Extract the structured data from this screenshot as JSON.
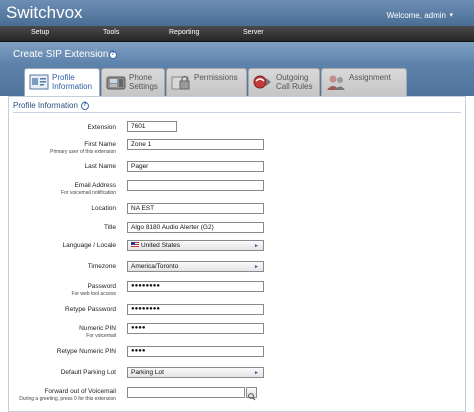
{
  "app": {
    "name": "Switchvox",
    "welcome": "Welcome, admin"
  },
  "nav": {
    "items": [
      "Setup",
      "Tools",
      "Reporting",
      "Server"
    ]
  },
  "page": {
    "title": "Create SIP Extension",
    "help": "?"
  },
  "tabs": [
    {
      "label1": "Profile",
      "label2": "Information",
      "icon": "profile-card-icon",
      "active": true
    },
    {
      "label1": "Phone",
      "label2": "Settings",
      "icon": "phone-icon",
      "active": false
    },
    {
      "label1": "Permissions",
      "label2": "",
      "icon": "lock-folder-icon",
      "active": false
    },
    {
      "label1": "Outgoing",
      "label2": "Call Rules",
      "icon": "call-rules-icon",
      "active": false
    },
    {
      "label1": "Assignment",
      "label2": "",
      "icon": "users-icon",
      "active": false
    }
  ],
  "section": {
    "title": "Profile Information",
    "help": "?"
  },
  "fields": {
    "extension": {
      "label": "Extension",
      "value": "7601"
    },
    "first_name": {
      "label": "First Name",
      "sub": "Primary user of this extension",
      "value": "Zone 1"
    },
    "last_name": {
      "label": "Last Name",
      "value": "Pager"
    },
    "email": {
      "label": "Email Address",
      "sub": "For voicemail notification",
      "value": ""
    },
    "location": {
      "label": "Location",
      "value": "NA EST"
    },
    "title": {
      "label": "Title",
      "value": "Algo 8180 Audio Alerter (G2)"
    },
    "language": {
      "label": "Language / Locale",
      "value": "United States"
    },
    "timezone": {
      "label": "Timezone",
      "value": "America/Toronto"
    },
    "password": {
      "label": "Password",
      "sub": "For web tool access",
      "value": "●●●●●●●●"
    },
    "retype_password": {
      "label": "Retype Password",
      "value": "●●●●●●●●"
    },
    "pin": {
      "label": "Numeric PIN",
      "sub": "For voicemail",
      "value": "●●●●"
    },
    "retype_pin": {
      "label": "Retype Numeric PIN",
      "value": "●●●●"
    },
    "parking_lot": {
      "label": "Default Parking Lot",
      "value": "Parking Lot"
    },
    "forward_vm": {
      "label": "Forward out of Voicemail",
      "sub": "During a greeting, press 0 for this extension",
      "value": ""
    }
  },
  "colors": {
    "header": "#5d82ab",
    "nav": "#333333",
    "accent": "#2b5fa6"
  }
}
